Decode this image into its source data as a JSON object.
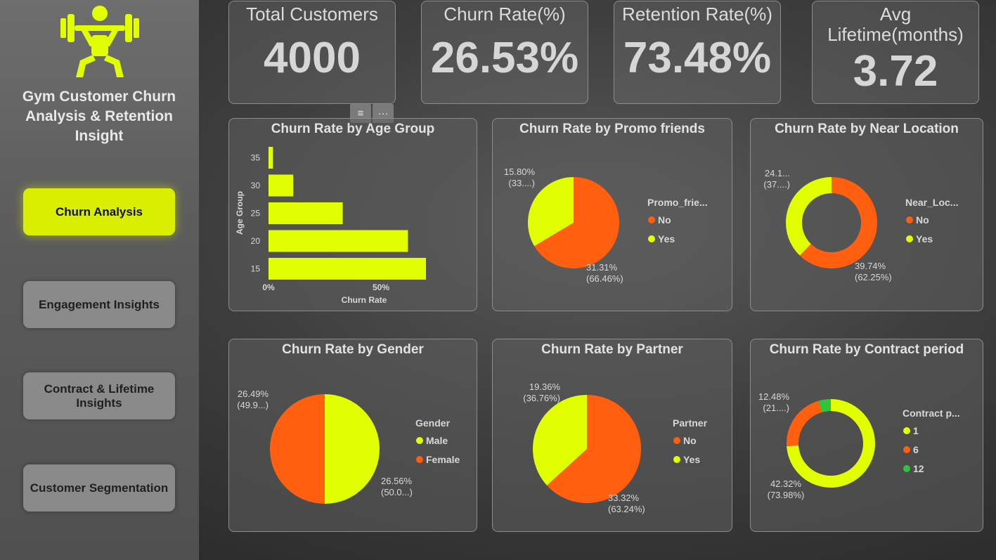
{
  "sidebar": {
    "title": "Gym Customer Churn Analysis & Retention Insight",
    "nav": [
      {
        "label": "Churn Analysis",
        "active": true
      },
      {
        "label": "Engagement Insights",
        "active": false
      },
      {
        "label": "Contract & Lifetime Insights",
        "active": false
      },
      {
        "label": "Customer Segmentation",
        "active": false
      }
    ]
  },
  "kpis": {
    "total_customers": {
      "label": "Total Customers",
      "value": "4000"
    },
    "churn_rate": {
      "label": "Churn Rate(%)",
      "value": "26.53%"
    },
    "retention_rate": {
      "label": "Retention Rate(%)",
      "value": "73.48%"
    },
    "avg_lifetime": {
      "label": "Avg Lifetime(months)",
      "value": "3.72"
    }
  },
  "toolbar": {
    "filter_icon": "≡",
    "more_icon": "···"
  },
  "colors": {
    "accent": "#e1ff00",
    "orange": "#ff5f0f",
    "green": "#2fc53a"
  },
  "chart_data": [
    {
      "type": "bar",
      "orientation": "horizontal",
      "title": "Churn Rate by Age Group",
      "xlabel": "Churn Rate",
      "ylabel": "Age Group",
      "categories": [
        "35",
        "30",
        "25",
        "20",
        "15"
      ],
      "values": [
        2,
        11,
        33,
        62,
        70
      ],
      "xticks": [
        "0%",
        "50%"
      ],
      "xlim": [
        0,
        80
      ]
    },
    {
      "type": "pie",
      "title": "Churn Rate by Promo friends",
      "legend_title": "Promo_frie...",
      "legend": [
        "No",
        "Yes"
      ],
      "slices": [
        {
          "name": "No",
          "share": 66.46,
          "label1": "31.31%",
          "label2": "(66.46%)",
          "color": "#ff5f0f"
        },
        {
          "name": "Yes",
          "share": 33.54,
          "label1": "15.80%",
          "label2": "(33....)",
          "color": "#e1ff00"
        }
      ]
    },
    {
      "type": "donut",
      "title": "Churn Rate by Near Location",
      "legend_title": "Near_Loc...",
      "legend": [
        "No",
        "Yes"
      ],
      "slices": [
        {
          "name": "No",
          "share": 62.25,
          "label1": "39.74%",
          "label2": "(62.25%)",
          "color": "#ff5f0f"
        },
        {
          "name": "Yes",
          "share": 37.75,
          "label1": "24.1...",
          "label2": "(37....)",
          "color": "#e1ff00"
        }
      ]
    },
    {
      "type": "pie",
      "title": "Churn Rate by Gender",
      "legend_title": "Gender",
      "legend": [
        "Male",
        "Female"
      ],
      "slices": [
        {
          "name": "Male",
          "share": 50.0,
          "label1": "26.56%",
          "label2": "(50.0...)",
          "color": "#e1ff00"
        },
        {
          "name": "Female",
          "share": 50.0,
          "label1": "26.49%",
          "label2": "(49.9...)",
          "color": "#ff5f0f"
        }
      ]
    },
    {
      "type": "pie",
      "title": "Churn Rate by Partner",
      "legend_title": "Partner",
      "legend": [
        "No",
        "Yes"
      ],
      "slices": [
        {
          "name": "No",
          "share": 63.24,
          "label1": "33.32%",
          "label2": "(63.24%)",
          "color": "#ff5f0f"
        },
        {
          "name": "Yes",
          "share": 36.76,
          "label1": "19.36%",
          "label2": "(36.76%)",
          "color": "#e1ff00"
        }
      ]
    },
    {
      "type": "donut",
      "title": "Churn Rate by Contract period",
      "legend_title": "Contract p...",
      "legend": [
        "1",
        "6",
        "12"
      ],
      "slices": [
        {
          "name": "1",
          "share": 73.98,
          "label1": "42.32%",
          "label2": "(73.98%)",
          "color": "#e1ff00"
        },
        {
          "name": "6",
          "share": 21.5,
          "label1": "12.48%",
          "label2": "(21....)",
          "color": "#ff5f0f"
        },
        {
          "name": "12",
          "share": 4.52,
          "label1": "",
          "label2": "",
          "color": "#2fc53a"
        }
      ]
    }
  ]
}
